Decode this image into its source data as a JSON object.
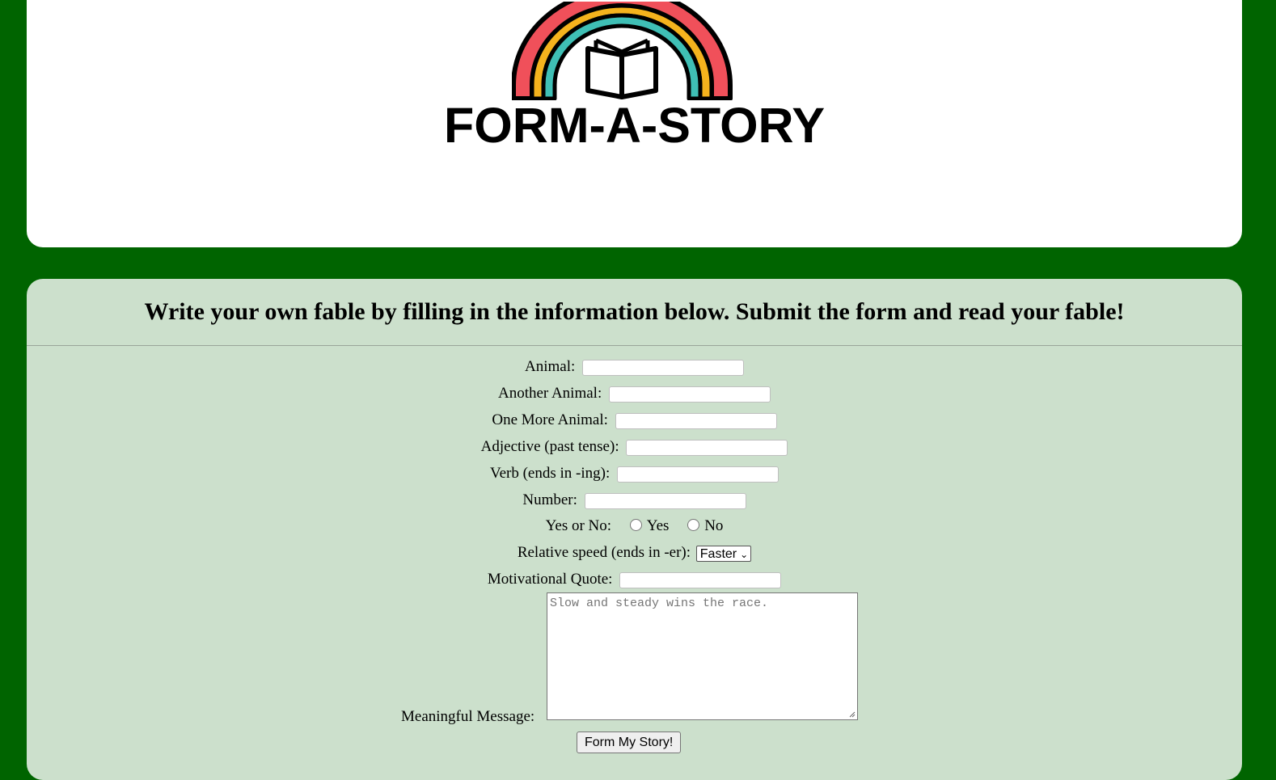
{
  "header": {
    "logo_text": "FORM-A-STORY"
  },
  "form": {
    "intro": "Write your own fable by filling in the information below. Submit the form and read your fable!",
    "fields": {
      "animal": "Animal:",
      "another_animal": "Another Animal:",
      "one_more_animal": "One More Animal:",
      "adjective": "Adjective (past tense):",
      "verb": "Verb (ends in -ing):",
      "number": "Number:",
      "yes_or_no": "Yes or No:",
      "yes_option": "Yes",
      "no_option": "No",
      "relative_speed": "Relative speed (ends in -er):",
      "relative_speed_selected": "Faster",
      "motivational_quote": "Motivational Quote:",
      "meaningful_message": "Meaningful Message:",
      "meaningful_message_placeholder": "Slow and steady wins the race."
    },
    "submit_label": "Form My Story!"
  },
  "colors": {
    "page_bg": "#006400",
    "form_bg": "#cce0cc",
    "rainbow_red": "#f0505a",
    "rainbow_yellow": "#f5b31d",
    "rainbow_teal": "#3fbfb5"
  },
  "icons": {
    "logo": "rainbow-book-icon",
    "select_arrow": "chevron-down-icon",
    "textarea_resize": "resize-grip-icon"
  }
}
